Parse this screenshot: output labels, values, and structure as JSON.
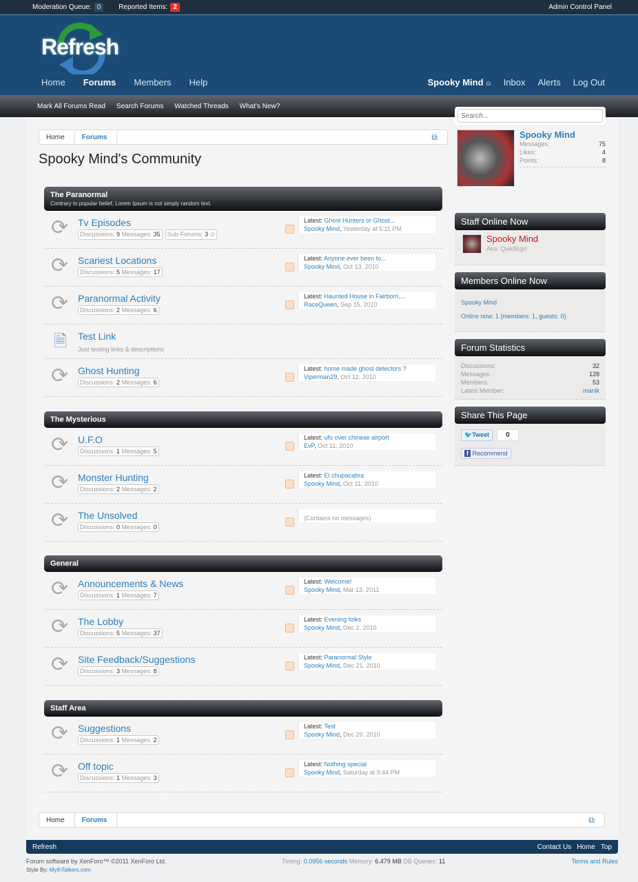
{
  "topbar": {
    "moderation_label": "Moderation Queue:",
    "moderation_count": "0",
    "reported_label": "Reported Items:",
    "reported_count": "2",
    "admin": "Admin Control Panel"
  },
  "logo": "Refresh",
  "nav": {
    "tabs": [
      "Home",
      "Forums",
      "Members",
      "Help"
    ],
    "user": "Spooky Mind",
    "right": [
      "Inbox",
      "Alerts",
      "Log Out"
    ]
  },
  "subnav": [
    "Mark All Forums Read",
    "Search Forums",
    "Watched Threads",
    "What's New?"
  ],
  "breadcrumb": [
    "Home",
    "Forums"
  ],
  "page_title": "Spooky Mind's Community",
  "labels": {
    "discussions": "Discussions:",
    "messages": "Messages:",
    "subforums": "Sub-Forums:",
    "latest": "Latest:"
  },
  "categories": [
    {
      "title": "The Paranormal",
      "desc": "Contrary to popular belief, Lorem Ipsum is not simply random text.",
      "forums": [
        {
          "title": "Tv Episodes",
          "discussions": "9",
          "messages": "35",
          "subforums": "3",
          "latest": "Ghost Hunters or Ghost...",
          "user": "Spooky Mind",
          "date": "Yesterday at 5:11 PM"
        },
        {
          "title": "Scariest Locations",
          "discussions": "5",
          "messages": "17",
          "latest": "Anyone ever been to...",
          "user": "Spooky Mind",
          "date": "Oct 13, 2010"
        },
        {
          "title": "Paranormal Activity",
          "discussions": "2",
          "messages": "6",
          "latest": "Haunted House in Fairborn,...",
          "user": "RaceQueen",
          "date": "Sep 15, 2010"
        },
        {
          "title": "Test Link",
          "link_desc": "Just testing links & descriptions"
        },
        {
          "title": "Ghost Hunting",
          "discussions": "2",
          "messages": "6",
          "latest": "home made ghost detectors ?",
          "user": "Viperman29",
          "date": "Oct 12, 2010"
        }
      ]
    },
    {
      "title": "The Mysterious",
      "forums": [
        {
          "title": "U.F.O",
          "discussions": "1",
          "messages": "5",
          "latest": "ufo over chinese airport",
          "user": "EvP",
          "date": "Oct 11, 2010"
        },
        {
          "title": "Monster Hunting",
          "discussions": "2",
          "messages": "2",
          "latest": "El chupacabra",
          "user": "Spooky Mind",
          "date": "Oct 11, 2010"
        },
        {
          "title": "The Unsolved",
          "discussions": "0",
          "messages": "0",
          "empty": "(Contains no messages)"
        }
      ]
    },
    {
      "title": "General",
      "forums": [
        {
          "title": "Announcements & News",
          "discussions": "1",
          "messages": "7",
          "latest": "Welcome!",
          "user": "Spooky Mind",
          "date": "Mar 13, 2011"
        },
        {
          "title": "The Lobby",
          "discussions": "5",
          "messages": "37",
          "latest": "Evening folks",
          "user": "Spooky Mind",
          "date": "Dec 2, 2010"
        },
        {
          "title": "Site Feedback/Suggestions",
          "discussions": "3",
          "messages": "8",
          "latest": "Paranormal Style",
          "user": "Spooky Mind",
          "date": "Dec 21, 2010"
        }
      ]
    },
    {
      "title": "Staff Area",
      "forums": [
        {
          "title": "Suggestions",
          "discussions": "1",
          "messages": "2",
          "latest": "Test",
          "user": "Spooky Mind",
          "date": "Dec 29, 2010"
        },
        {
          "title": "Off topic",
          "discussions": "1",
          "messages": "3",
          "latest": "Nothing special",
          "user": "Spooky Mind",
          "date": "Saturday at 9:44 PM"
        }
      ]
    }
  ],
  "sidebar": {
    "search_placeholder": "Search...",
    "visitor": {
      "name": "Spooky Mind",
      "stats": [
        [
          "Messages:",
          "75"
        ],
        [
          "Likes:",
          "4"
        ],
        [
          "Points:",
          "8"
        ]
      ]
    },
    "staff": {
      "title": "Staff Online Now",
      "name": "Spooky Mind",
      "aka": "Aka: Qwk86gn"
    },
    "members": {
      "title": "Members Online Now",
      "name": "Spooky Mind",
      "summary": "Online now: 1 (members: 1, guests: 0)"
    },
    "stats": {
      "title": "Forum Statistics",
      "rows": [
        [
          "Discussions:",
          "32"
        ],
        [
          "Messages:",
          "128"
        ],
        [
          "Members:",
          "53"
        ],
        [
          "Latest Member:",
          "manik"
        ]
      ]
    },
    "share": {
      "title": "Share This Page",
      "tweet": "Tweet",
      "tweet_count": "0",
      "recommend": "Recommend"
    }
  },
  "footer": {
    "brand": "Refresh",
    "links": [
      "Contact Us",
      "Home",
      "Top"
    ],
    "copyright": "Forum software by XenForo™ ©2011 XenForo Ltd.",
    "style_label": "Style By:",
    "style_link": "MythTalkers.com",
    "timing_label": "Timing:",
    "timing": "0.0956 seconds",
    "memory_label": "Memory:",
    "memory": "6.479 MB",
    "db_label": "DB Queries:",
    "db": "11",
    "terms": "Terms and Rules"
  }
}
